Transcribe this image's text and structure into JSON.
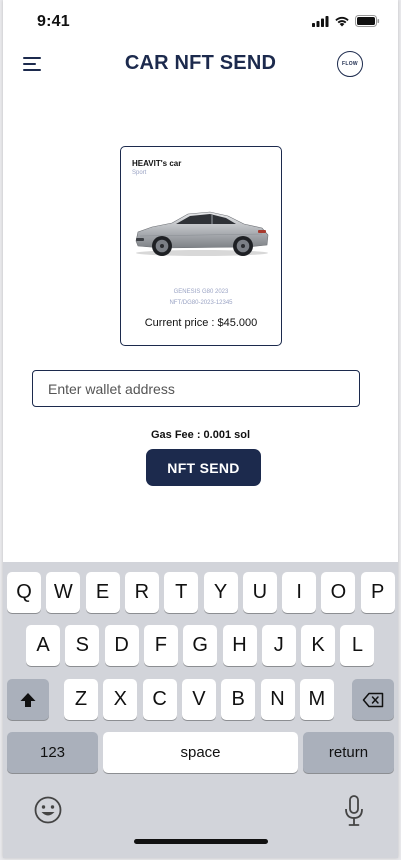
{
  "status_bar": {
    "time": "9:41"
  },
  "header": {
    "title": "CAR NFT SEND",
    "logo_text": "FLOW"
  },
  "card": {
    "owner": "HEAVIT's car",
    "category": "Sport",
    "model": "GENESIS G80 2023",
    "nft_id": "NFT/DG80-2023-12345",
    "price": "Current price : $45.000"
  },
  "wallet": {
    "placeholder": "Enter wallet address",
    "value": ""
  },
  "gas_fee": "Gas Fee : 0.001 sol",
  "send_button": "NFT SEND",
  "keyboard": {
    "row1": [
      "Q",
      "W",
      "E",
      "R",
      "T",
      "Y",
      "U",
      "I",
      "O",
      "P"
    ],
    "row2": [
      "A",
      "S",
      "D",
      "F",
      "G",
      "H",
      "J",
      "K",
      "L"
    ],
    "row3": [
      "Z",
      "X",
      "C",
      "V",
      "B",
      "N",
      "M"
    ],
    "numbers_key": "123",
    "space_key": "space",
    "return_key": "return",
    "shift_icon": "shift-icon",
    "backspace_icon": "backspace-icon",
    "emoji_icon": "emoji-icon",
    "mic_icon": "microphone-icon"
  },
  "colors": {
    "accent": "#1c2a4d",
    "muted_text": "#9aa3c4",
    "keyboard_bg": "#d2d4da",
    "key_dark": "#aab0bb"
  }
}
